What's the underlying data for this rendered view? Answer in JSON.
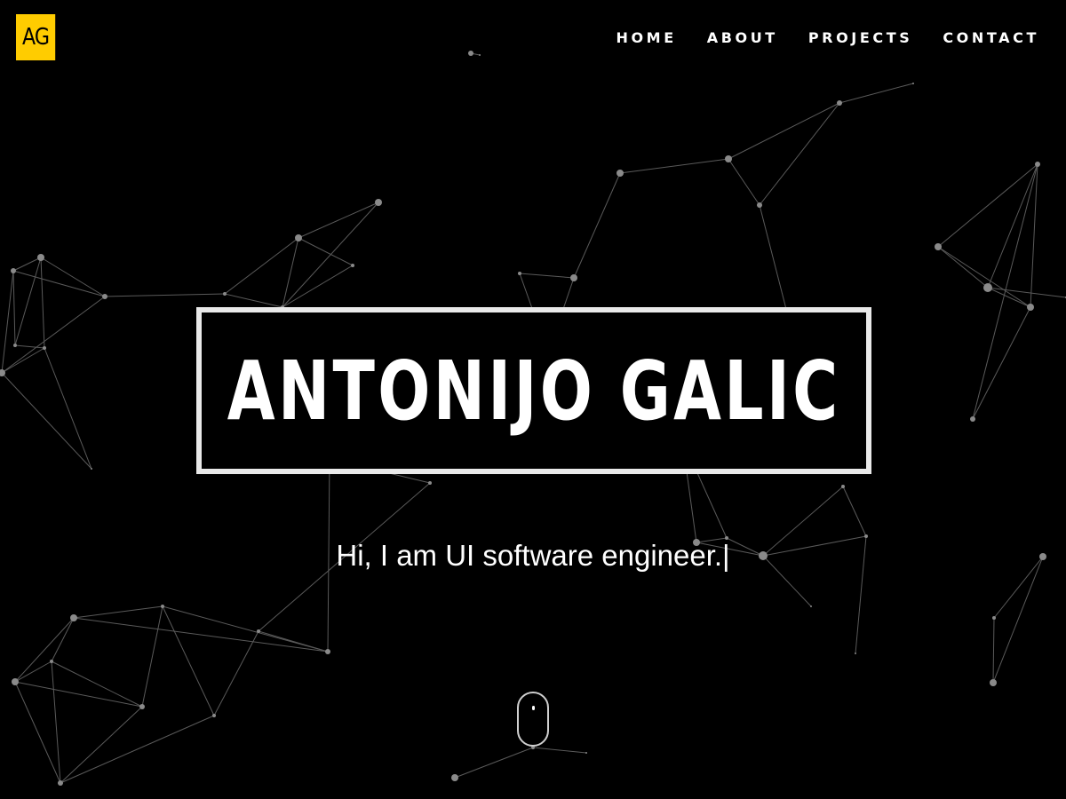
{
  "logo": {
    "text": "AG",
    "color": "#ffcc00"
  },
  "nav": {
    "items": [
      {
        "label": "HOME"
      },
      {
        "label": "ABOUT"
      },
      {
        "label": "PROJECTS"
      },
      {
        "label": "CONTACT"
      }
    ]
  },
  "hero": {
    "title": "ANTONIJO GALIC",
    "tagline": "Hi, I am UI software engineer.|"
  },
  "colors": {
    "background": "#000000",
    "accent": "#ffcc00",
    "text": "#ffffff",
    "border": "#e9e9e9"
  },
  "icons": {
    "scroll": "mouse-scroll-icon"
  }
}
